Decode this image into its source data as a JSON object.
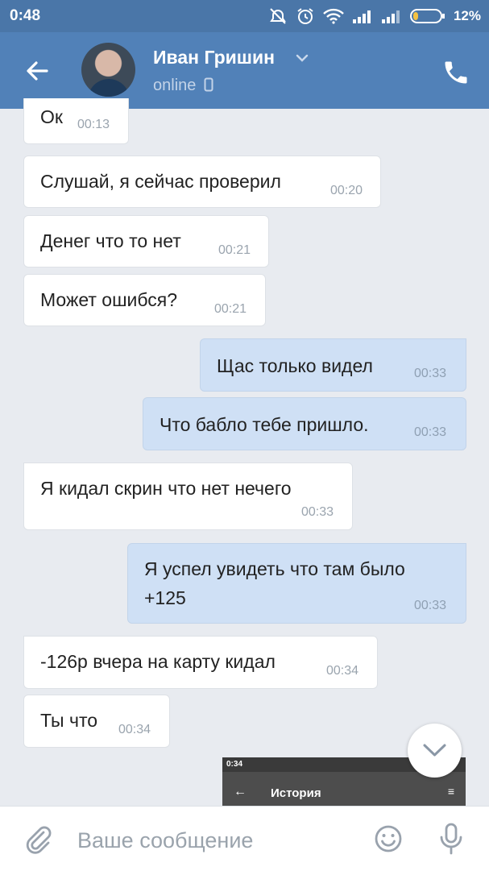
{
  "status": {
    "time": "0:48",
    "battery": "12%"
  },
  "header": {
    "name": "Иван Гришин",
    "presence": "online"
  },
  "messages": [
    {
      "dir": "in",
      "text": "Ок",
      "time": "00:13"
    },
    {
      "dir": "in",
      "text": "Слушай, я сейчас проверил",
      "time": "00:20"
    },
    {
      "dir": "in",
      "text": "Денег что то нет",
      "time": "00:21"
    },
    {
      "dir": "in",
      "text": "Может ошибся?",
      "time": "00:21"
    },
    {
      "dir": "out",
      "text": "Щас только видел",
      "time": "00:33"
    },
    {
      "dir": "out",
      "text": "Что бабло тебе пришло.",
      "time": "00:33"
    },
    {
      "dir": "in",
      "text": "Я кидал скрин что нет нечего",
      "time": "00:33"
    },
    {
      "dir": "out",
      "text": "Я успел увидеть что там было",
      "text2": "+125",
      "time": "00:33"
    },
    {
      "dir": "in",
      "text": "-126р вчера на карту кидал",
      "time": "00:34"
    },
    {
      "dir": "in",
      "text": "Ты что",
      "time": "00:34"
    }
  ],
  "preview": {
    "time": "0:34",
    "title": "История",
    "back": "←",
    "filter": "≡"
  },
  "composer": {
    "placeholder": "Ваше сообщение"
  },
  "colors": {
    "header": "#5181b8",
    "statusbar": "#4a76a8",
    "incoming": "#ffffff",
    "outgoing": "#cfe0f5",
    "background": "#e8ebf0"
  },
  "icons": [
    "back-arrow-icon",
    "chevron-down-icon",
    "phone-icon",
    "mobile-icon",
    "attach-icon",
    "emoji-icon",
    "mic-icon",
    "chevron-down-fab-icon"
  ]
}
